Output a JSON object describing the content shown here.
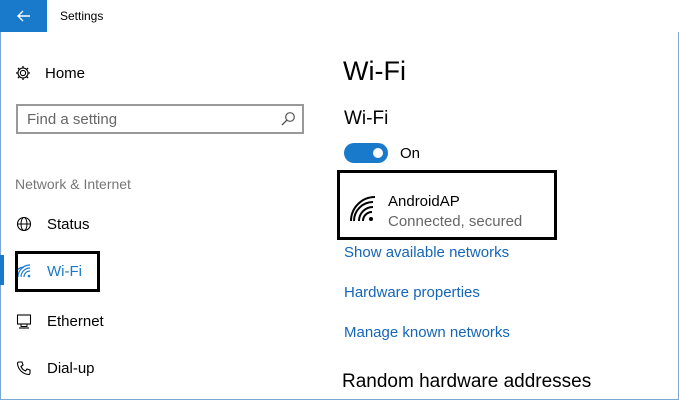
{
  "window": {
    "title": "Settings"
  },
  "sidebar": {
    "home_label": "Home",
    "search_placeholder": "Find a setting",
    "section_heading": "Network & Internet",
    "items": [
      {
        "label": "Status",
        "icon": "globe-icon"
      },
      {
        "label": "Wi-Fi",
        "icon": "wifi-icon",
        "selected": true
      },
      {
        "label": "Ethernet",
        "icon": "ethernet-icon"
      },
      {
        "label": "Dial-up",
        "icon": "phone-icon"
      }
    ]
  },
  "main": {
    "page_title": "Wi-Fi",
    "wifi_subtitle": "Wi-Fi",
    "toggle_state": "On",
    "network": {
      "name": "AndroidAP",
      "status": "Connected, secured"
    },
    "links": {
      "show_networks": "Show available networks",
      "hardware": "Hardware properties",
      "manage": "Manage known networks"
    },
    "random_hw_title": "Random hardware addresses"
  },
  "colors": {
    "accent": "#1979ca",
    "link": "#1565b8",
    "muted": "#767676"
  }
}
